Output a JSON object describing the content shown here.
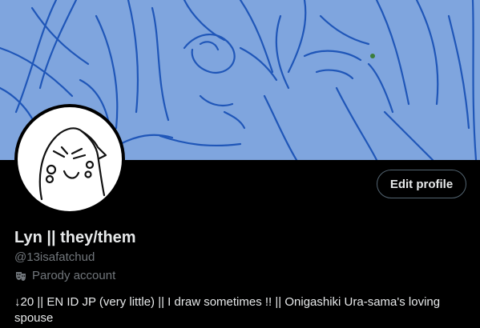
{
  "profile": {
    "display_name": "Lyn || they/them",
    "handle": "@13isafatchud",
    "parody_label": "Parody account",
    "bio": "↓20 || EN ID JP (very little) || I draw sometimes !! || Onigashiki Ura-sama's loving spouse"
  },
  "actions": {
    "edit_profile_label": "Edit profile"
  },
  "icons": {
    "parody": "theater-masks-icon"
  },
  "colors": {
    "banner_bg": "#7fa5de",
    "sketch_stroke": "#1f56b8",
    "page_bg": "#000000",
    "primary_text": "#e7e9ea",
    "secondary_text": "#71767b",
    "button_border": "#536471"
  }
}
